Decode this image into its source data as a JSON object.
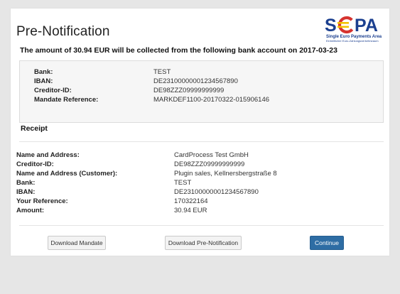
{
  "page": {
    "title": "Pre-Notification",
    "headline": "The amount of 30.94 EUR will be collected from the following bank account on 2017-03-23"
  },
  "logo": {
    "text_s": "S",
    "text_pa": "PA",
    "tagline": "Single Euro Payments Area",
    "subtagline": "Einheitlicher Euro-Zahlungsverkehrsraum",
    "colors": {
      "blue": "#1b3f8f",
      "yellow": "#f3c300",
      "red": "#d6332f"
    }
  },
  "bank_details": [
    {
      "label": "Bank:",
      "value": "TEST"
    },
    {
      "label": "IBAN:",
      "value": "DE23100000001234567890"
    },
    {
      "label": "Creditor-ID:",
      "value": "DE98ZZZ09999999999"
    },
    {
      "label": "Mandate Reference:",
      "value": "MARKDEF1100-20170322-015906146"
    }
  ],
  "receipt": {
    "title": "Receipt",
    "rows": [
      {
        "label": "Name and Address:",
        "value": "CardProcess Test GmbH"
      },
      {
        "label": "Creditor-ID:",
        "value": "DE98ZZZ09999999999"
      },
      {
        "label": "Name and Address (Customer):",
        "value": "Plugin sales, Kellnersbergstraße 8"
      },
      {
        "label": "Bank:",
        "value": "TEST"
      },
      {
        "label": "IBAN:",
        "value": "DE23100000001234567890"
      },
      {
        "label": "Your Reference:",
        "value": "170322164"
      },
      {
        "label": "Amount:",
        "value": "30.94 EUR"
      }
    ]
  },
  "buttons": {
    "download_mandate": "Download Mandate",
    "download_prenotification": "Download Pre-Notification",
    "continue": "Continue"
  },
  "colors": {
    "primary": "#2e6da4",
    "background": "#e6e6e6"
  }
}
